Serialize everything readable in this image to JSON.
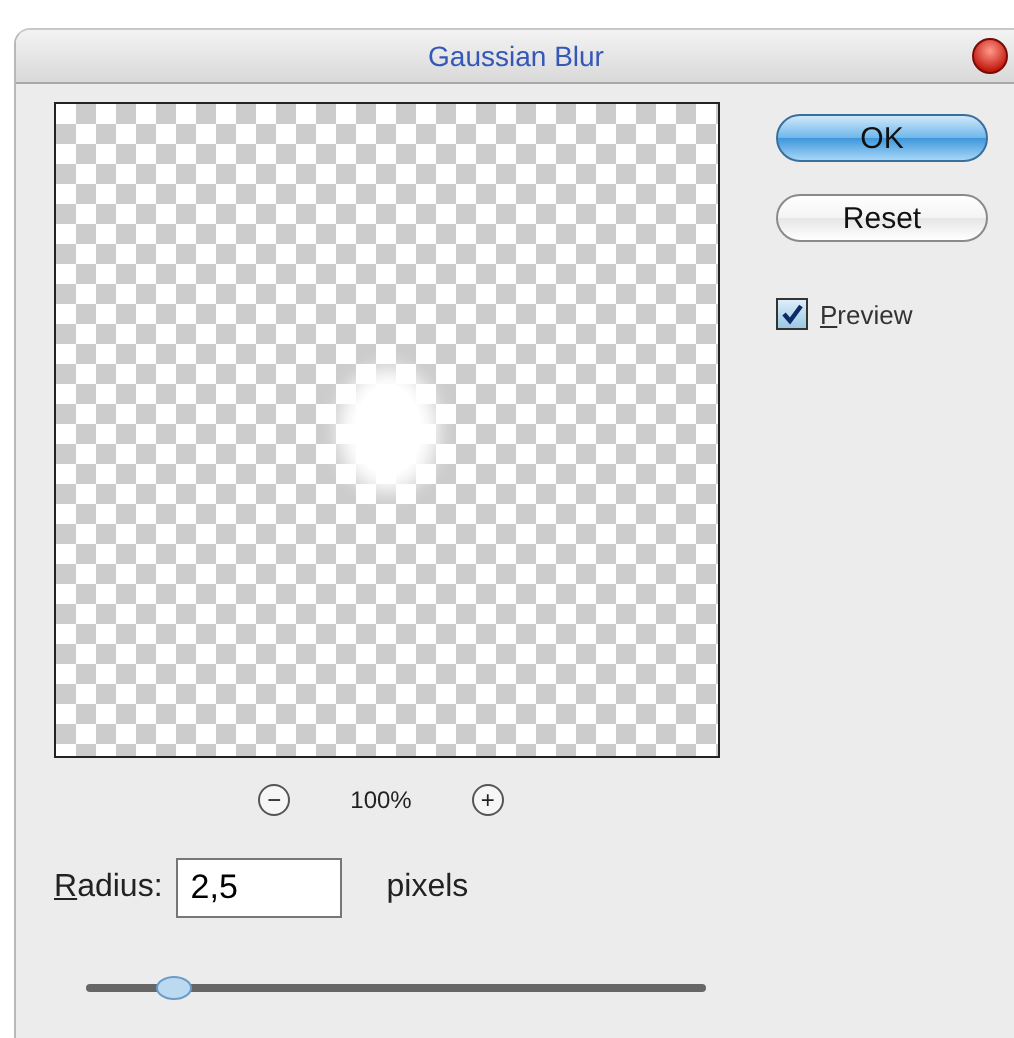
{
  "window": {
    "title": "Gaussian Blur"
  },
  "buttons": [
    {
      "label": "OK",
      "default": true
    },
    {
      "label": "Reset",
      "default": false
    }
  ],
  "preview": {
    "label": "Preview",
    "checked": true
  },
  "zoom": {
    "minus": "−",
    "value": "100%",
    "plus": "+"
  },
  "radius": {
    "label": "Radius:",
    "value": "2,5",
    "unit": "pixels"
  },
  "slider": {
    "level": 0.14
  }
}
